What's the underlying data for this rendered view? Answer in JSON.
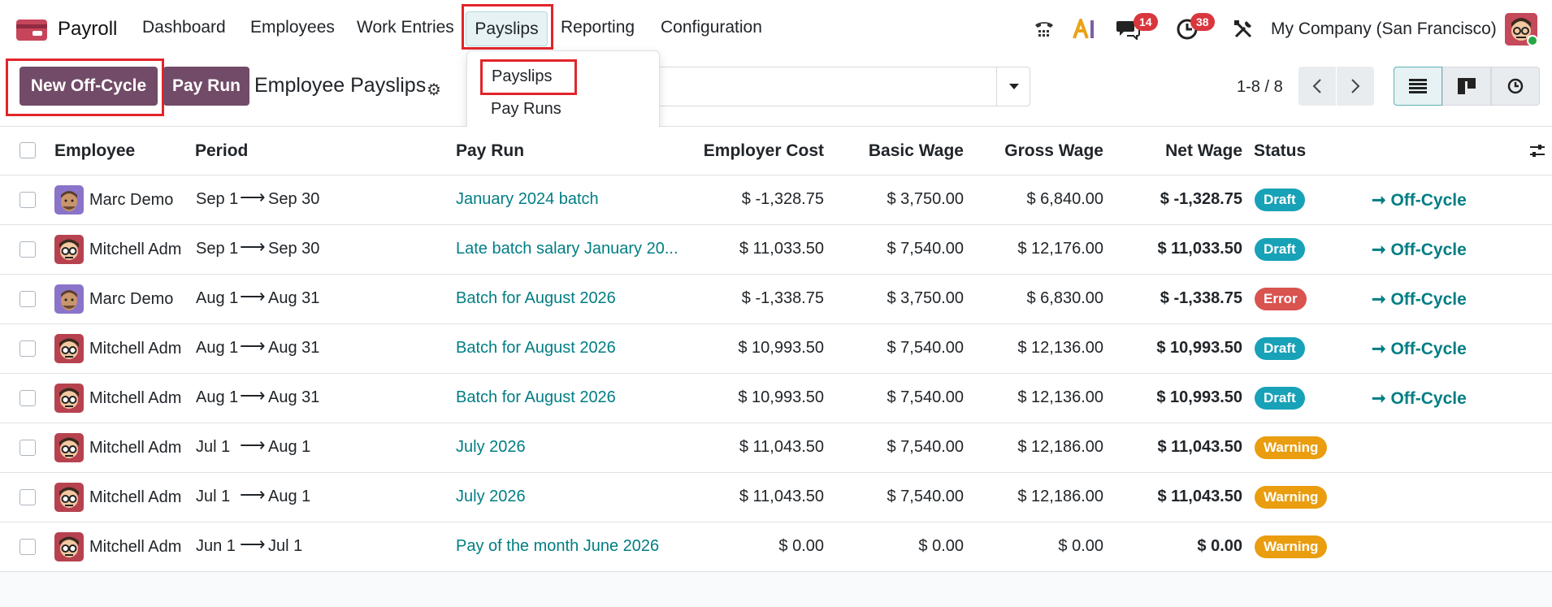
{
  "app": {
    "name": "Payroll"
  },
  "menu": [
    {
      "label": "Dashboard"
    },
    {
      "label": "Employees"
    },
    {
      "label": "Work Entries"
    },
    {
      "label": "Payslips"
    },
    {
      "label": "Reporting"
    },
    {
      "label": "Configuration"
    }
  ],
  "dropdown": {
    "items": [
      {
        "label": "Payslips"
      },
      {
        "label": "Pay Runs"
      }
    ]
  },
  "systray": {
    "messages_count": "14",
    "activities_count": "38",
    "company": "My Company (San Francisco)"
  },
  "control": {
    "new_offcycle": "New Off-Cycle",
    "pay_run": "Pay Run",
    "title": "Employee Payslips",
    "pager": "1-8 / 8"
  },
  "columns": {
    "employee": "Employee",
    "period": "Period",
    "pay_run": "Pay Run",
    "employer_cost": "Employer Cost",
    "basic_wage": "Basic Wage",
    "gross_wage": "Gross Wage",
    "net_wage": "Net Wage",
    "status": "Status"
  },
  "rows": [
    {
      "employee": "Marc Demo",
      "from": "Sep 1",
      "to": "Sep 30",
      "pay_run": "January 2024 batch",
      "employer_cost": "$ -1,328.75",
      "basic": "$ 3,750.00",
      "gross": "$ 6,840.00",
      "net": "$ -1,328.75",
      "status": "Draft",
      "action": "Off-Cycle"
    },
    {
      "employee": "Mitchell Adm",
      "from": "Sep 1",
      "to": "Sep 30",
      "pay_run": "Late batch salary January 20...",
      "employer_cost": "$ 11,033.50",
      "basic": "$ 7,540.00",
      "gross": "$ 12,176.00",
      "net": "$ 11,033.50",
      "status": "Draft",
      "action": "Off-Cycle"
    },
    {
      "employee": "Marc Demo",
      "from": "Aug 1",
      "to": "Aug 31",
      "pay_run": "Batch for August 2026",
      "employer_cost": "$ -1,338.75",
      "basic": "$ 3,750.00",
      "gross": "$ 6,830.00",
      "net": "$ -1,338.75",
      "status": "Error",
      "action": "Off-Cycle"
    },
    {
      "employee": "Mitchell Adm",
      "from": "Aug 1",
      "to": "Aug 31",
      "pay_run": "Batch for August 2026",
      "employer_cost": "$ 10,993.50",
      "basic": "$ 7,540.00",
      "gross": "$ 12,136.00",
      "net": "$ 10,993.50",
      "status": "Draft",
      "action": "Off-Cycle"
    },
    {
      "employee": "Mitchell Adm",
      "from": "Aug 1",
      "to": "Aug 31",
      "pay_run": "Batch for August 2026",
      "employer_cost": "$ 10,993.50",
      "basic": "$ 7,540.00",
      "gross": "$ 12,136.00",
      "net": "$ 10,993.50",
      "status": "Draft",
      "action": "Off-Cycle"
    },
    {
      "employee": "Mitchell Adm",
      "from": "Jul 1",
      "to": "Aug 1",
      "pay_run": "July 2026",
      "employer_cost": "$ 11,043.50",
      "basic": "$ 7,540.00",
      "gross": "$ 12,186.00",
      "net": "$ 11,043.50",
      "status": "Warning",
      "action": ""
    },
    {
      "employee": "Mitchell Adm",
      "from": "Jul 1",
      "to": "Aug 1",
      "pay_run": "July 2026",
      "employer_cost": "$ 11,043.50",
      "basic": "$ 7,540.00",
      "gross": "$ 12,186.00",
      "net": "$ 11,043.50",
      "status": "Warning",
      "action": ""
    },
    {
      "employee": "Mitchell Adm",
      "from": "Jun 1",
      "to": "Jul 1",
      "pay_run": "Pay of the month June 2026",
      "employer_cost": "$ 0.00",
      "basic": "$ 0.00",
      "gross": "$ 0.00",
      "net": "$ 0.00",
      "status": "Warning",
      "action": ""
    }
  ],
  "colors": {
    "brand": "#714b67",
    "link": "#017e84",
    "draft": "#17a2b8",
    "error": "#d9534f",
    "warning": "#e99d0f",
    "highlight": "#e1252b"
  }
}
